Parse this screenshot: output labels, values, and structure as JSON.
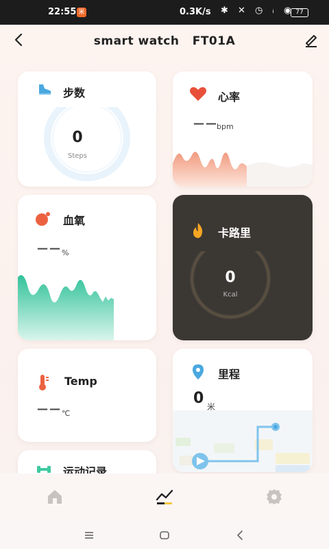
{
  "status": {
    "time": "22:55",
    "badge": "米",
    "net_speed": "0.3K/s",
    "icons": "✱ ✕ ◷ ᵢ ◉",
    "battery": "77"
  },
  "header": {
    "title": "smart watch   FT01A"
  },
  "cards": {
    "steps": {
      "title": "步数",
      "value": "0",
      "unit": "Steps"
    },
    "heart": {
      "title": "心率",
      "value": "——",
      "unit": "bpm"
    },
    "oxygen": {
      "title": "血氧",
      "value": "——",
      "unit": "%"
    },
    "calories": {
      "title": "卡路里",
      "value": "0",
      "unit": "Kcal"
    },
    "temp": {
      "title": "Temp",
      "value": "——",
      "unit": "℃"
    },
    "distance": {
      "title": "里程",
      "value": "0",
      "unit": "米"
    },
    "exercise": {
      "title": "运动记录"
    }
  },
  "colors": {
    "accent_blue": "#4a9fdc",
    "heart_red": "#e8503a",
    "oxygen_green": "#3fc9a0",
    "flame_orange": "#f5a623",
    "dark_card": "#3b3733"
  },
  "nav": {
    "items": [
      {
        "icon": "home-icon"
      },
      {
        "icon": "chart-icon"
      },
      {
        "icon": "gear-icon"
      }
    ]
  }
}
